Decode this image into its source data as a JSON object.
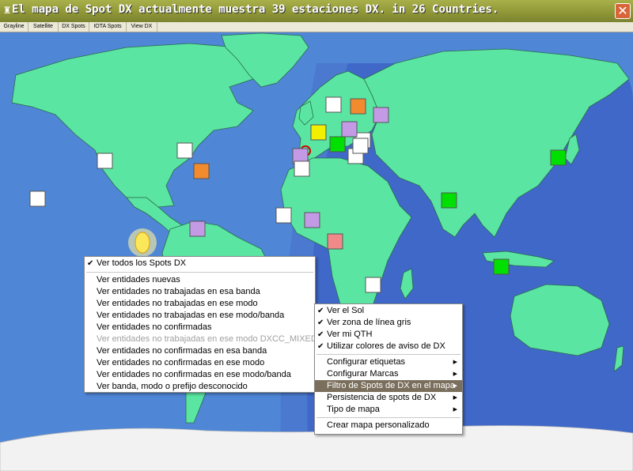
{
  "window": {
    "title": "El mapa de Spot DX actualmente muestra 39 estaciones DX. in 26 Countries.",
    "close_glyph": "✕",
    "app_icon": "♜"
  },
  "tabs": [
    "Grayline",
    "Satellite",
    "DX Spots",
    "IOTA Spots",
    "View DX"
  ],
  "left_menu": {
    "items": [
      {
        "label": "Ver todos los Spots DX",
        "checked": true
      },
      {
        "label": "Ver entidades nuevas"
      },
      {
        "label": "Ver entidades no trabajadas en esa banda"
      },
      {
        "label": "Ver entidades no trabajadas en ese modo"
      },
      {
        "label": "Ver entidades no trabajadas en ese modo/banda"
      },
      {
        "label": "Ver entidades no confirmadas"
      },
      {
        "label": "Ver entidades no trabajadas en ese modo DXCC_MIXED",
        "disabled": true
      },
      {
        "label": "Ver entidades no confirmadas en esa banda"
      },
      {
        "label": "Ver entidades no confirmadas en ese modo"
      },
      {
        "label": "Ver entidades no confirmadas en ese modo/banda"
      },
      {
        "label": "Ver banda, modo o prefijo desconocido"
      }
    ]
  },
  "right_menu": {
    "items": [
      {
        "label": "Ver el Sol",
        "checked": true
      },
      {
        "label": "Ver zona de línea gris",
        "checked": true
      },
      {
        "label": "Ver mi QTH",
        "checked": true
      },
      {
        "label": "Utilizar colores de aviso de DX",
        "checked": true
      },
      {
        "label": "Configurar etiquetas",
        "submenu": true
      },
      {
        "label": "Configurar Marcas",
        "submenu": true
      },
      {
        "label": "Filtro de Spots de DX en el mapa",
        "submenu": true,
        "highlighted": true
      },
      {
        "label": "Persistencia de spots de DX",
        "submenu": true
      },
      {
        "label": "Tipo de mapa",
        "submenu": true
      },
      {
        "label": "Crear mapa personalizado"
      }
    ]
  },
  "colors": {
    "ocean": "#4f86d6",
    "land": "#5ae6a2",
    "night": "#3f68c8",
    "spot_white": "#ffffff",
    "spot_orange": "#f28a2e",
    "spot_violet": "#c49ae6",
    "spot_yellow": "#f2f000",
    "spot_green": "#00e000",
    "spot_salmon": "#f08a8a"
  },
  "spots": [
    {
      "color": "white"
    },
    {
      "color": "white"
    },
    {
      "color": "white"
    },
    {
      "color": "orange"
    },
    {
      "color": "violet"
    },
    {
      "color": "white"
    },
    {
      "color": "orange"
    },
    {
      "color": "violet"
    },
    {
      "color": "yellow"
    },
    {
      "color": "violet"
    },
    {
      "color": "white"
    },
    {
      "color": "green"
    },
    {
      "color": "white"
    },
    {
      "color": "violet"
    },
    {
      "color": "white"
    },
    {
      "color": "white"
    },
    {
      "color": "white"
    },
    {
      "color": "violet"
    },
    {
      "color": "salmon"
    },
    {
      "color": "green"
    },
    {
      "color": "green"
    },
    {
      "color": "green"
    },
    {
      "color": "white"
    }
  ]
}
